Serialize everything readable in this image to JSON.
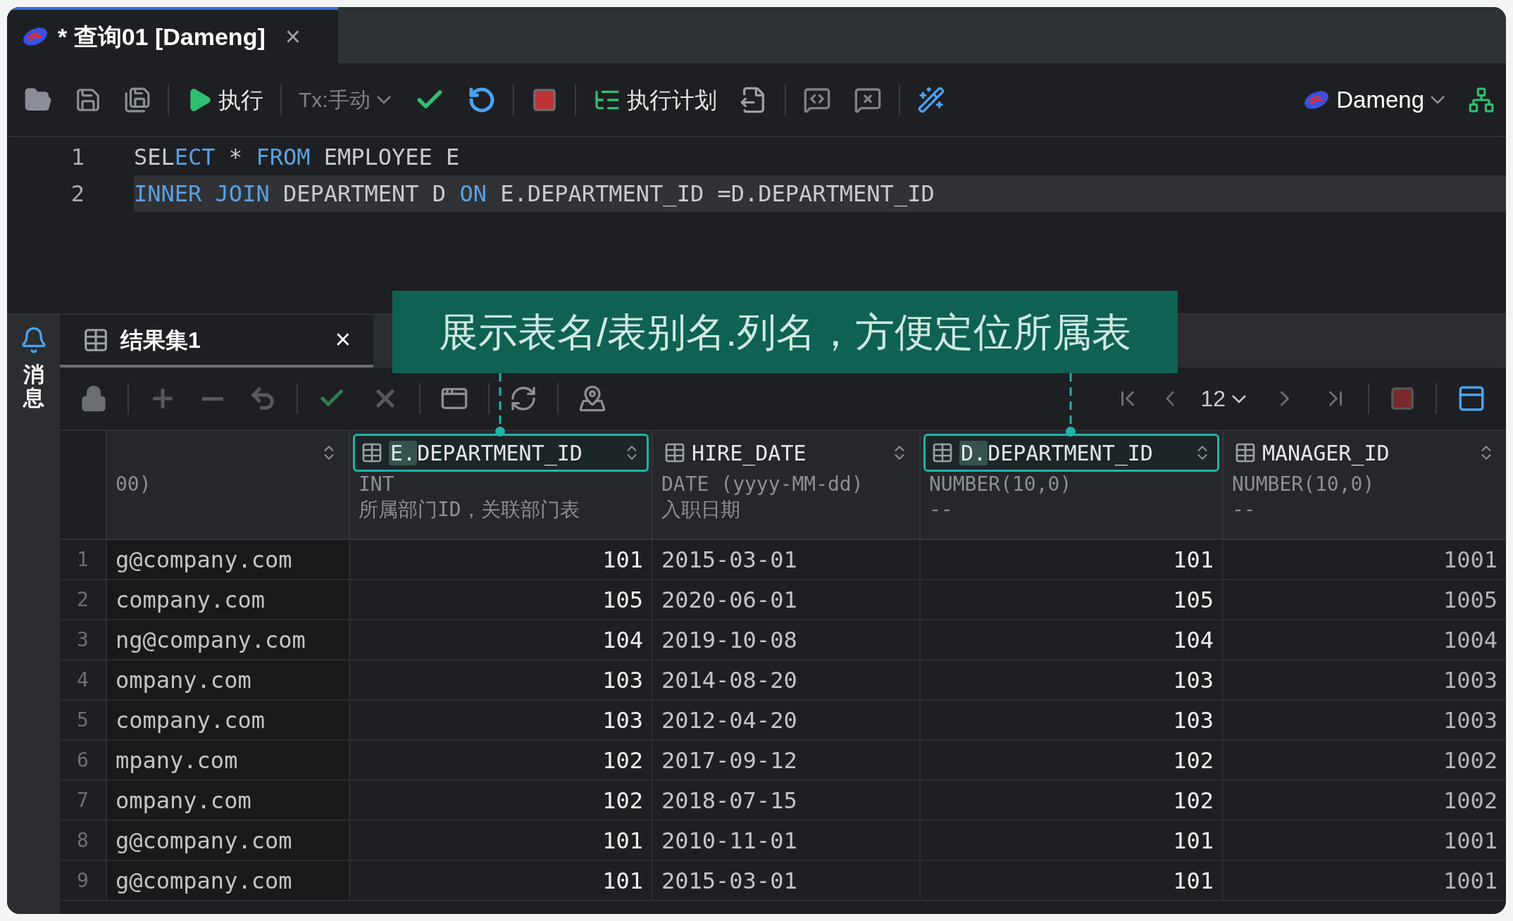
{
  "tab": {
    "title": "* 查询01 [Dameng]",
    "close": "×",
    "selected": true
  },
  "toolbar": {
    "run": "执行",
    "tx": "Tx:手动",
    "plan": "执行计划",
    "connection": "Dameng"
  },
  "editor": {
    "lines": [
      {
        "number": "1",
        "current": false,
        "tokens": [
          {
            "text": "SEL",
            "kind": "plain"
          },
          {
            "text": "ECT",
            "kind": "keyword"
          },
          {
            "text": " * ",
            "kind": "plain"
          },
          {
            "text": "FROM",
            "kind": "keyword"
          },
          {
            "text": " EMPLOYEE E",
            "kind": "plain"
          }
        ]
      },
      {
        "number": "2",
        "current": true,
        "tokens": [
          {
            "text": "INNER JOIN",
            "kind": "keyword"
          },
          {
            "text": " DEPARTMENT D ",
            "kind": "plain"
          },
          {
            "text": "ON",
            "kind": "keyword"
          },
          {
            "text": " E.DEPARTMENT_ID =D.DEPARTMENT_ID",
            "kind": "plain"
          }
        ]
      }
    ]
  },
  "messages_sidebar": {
    "label": "消息"
  },
  "results_tab": {
    "title": "结果集1",
    "close": "×",
    "selected": true
  },
  "callout": {
    "text": "展示表名/表别名.列名，方便定位所属表"
  },
  "pager": {
    "page_size": "12"
  },
  "columns": [
    {
      "kind": "text",
      "type": "00)",
      "highlighted": false
    },
    {
      "kind": "number",
      "alias": "E.",
      "name": "DEPARTMENT_ID",
      "type": "INT",
      "comment": "所属部门ID，关联部门表",
      "highlighted": true
    },
    {
      "kind": "date",
      "name": "HIRE_DATE",
      "type": "DATE (yyyy-MM-dd)",
      "comment": "入职日期",
      "highlighted": false
    },
    {
      "kind": "number",
      "alias": "D.",
      "name": "DEPARTMENT_ID",
      "type": "NUMBER(10,0)",
      "comment": "--",
      "highlighted": true
    },
    {
      "kind": "number",
      "name": "MANAGER_ID",
      "type": "NUMBER(10,0)",
      "comment": "--",
      "highlighted": false
    }
  ],
  "rows": [
    {
      "number": "1",
      "cells": [
        "g@company.com",
        "101",
        "2015-03-01",
        "101",
        "1001"
      ]
    },
    {
      "number": "2",
      "cells": [
        "company.com",
        "105",
        "2020-06-01",
        "105",
        "1005"
      ]
    },
    {
      "number": "3",
      "cells": [
        "ng@company.com",
        "104",
        "2019-10-08",
        "104",
        "1004"
      ]
    },
    {
      "number": "4",
      "cells": [
        "ompany.com",
        "103",
        "2014-08-20",
        "103",
        "1003"
      ]
    },
    {
      "number": "5",
      "cells": [
        "company.com",
        "103",
        "2012-04-20",
        "103",
        "1003"
      ]
    },
    {
      "number": "6",
      "cells": [
        "mpany.com",
        "102",
        "2017-09-12",
        "102",
        "1002"
      ]
    },
    {
      "number": "7",
      "cells": [
        "ompany.com",
        "102",
        "2018-07-15",
        "102",
        "1002"
      ]
    },
    {
      "number": "8",
      "cells": [
        "g@company.com",
        "101",
        "2010-11-01",
        "101",
        "1001"
      ]
    },
    {
      "number": "9",
      "cells": [
        "g@company.com",
        "101",
        "2015-03-01",
        "101",
        "1001"
      ]
    }
  ]
}
